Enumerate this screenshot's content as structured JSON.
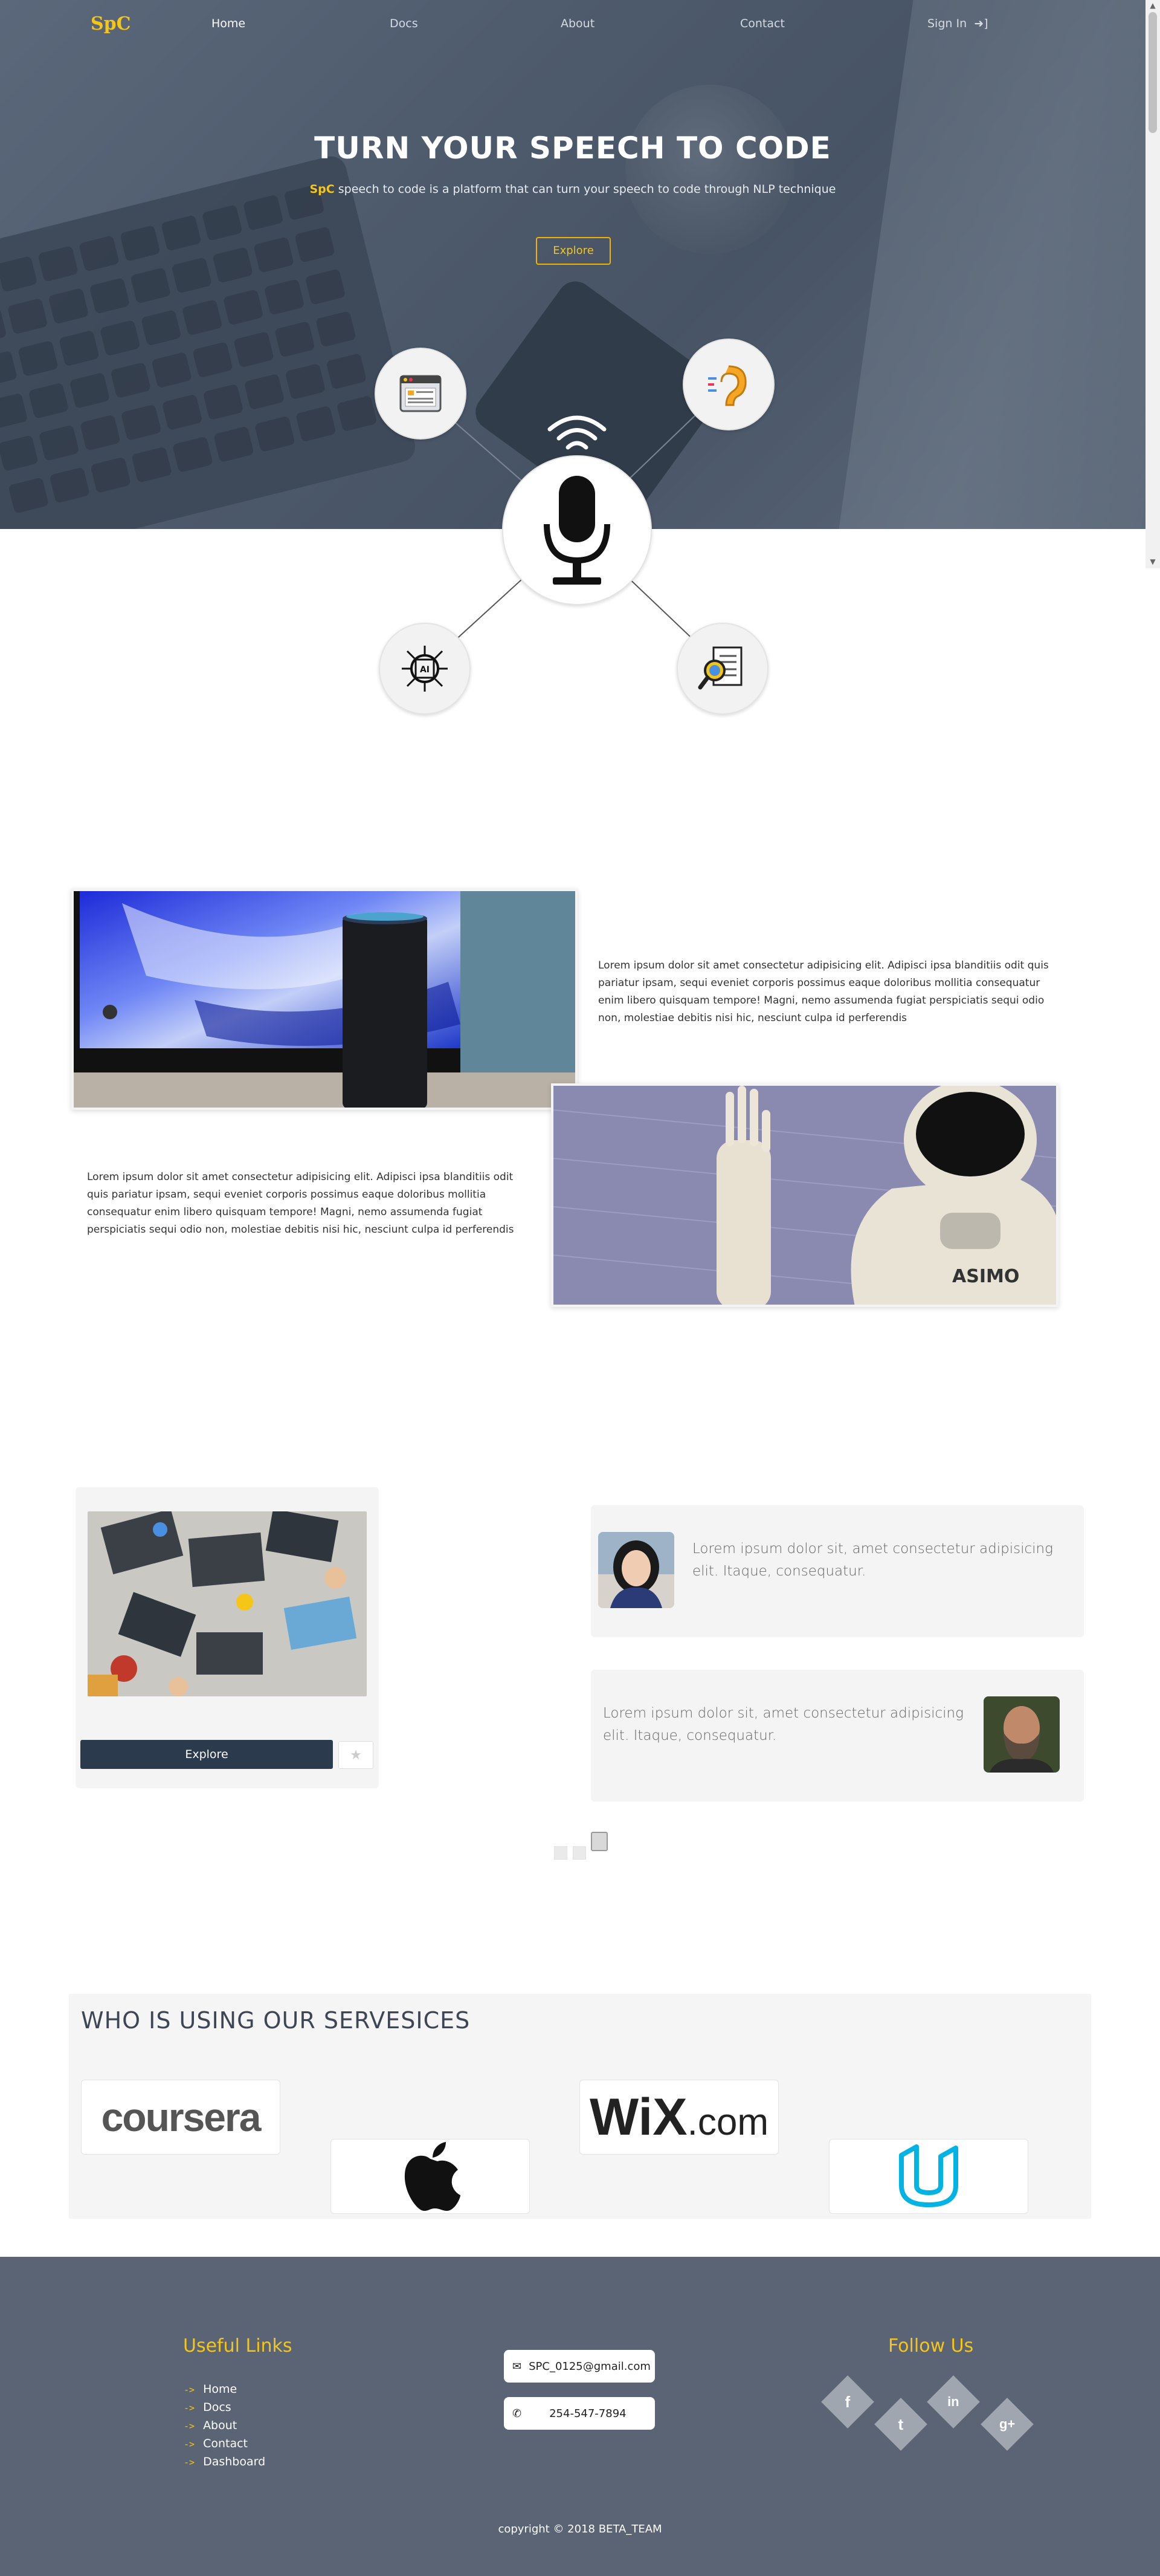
{
  "nav": {
    "brand": "SpC",
    "links": [
      "Home",
      "Docs",
      "About",
      "Contact"
    ],
    "sign_in": "Sign In"
  },
  "hero": {
    "title": "TURN YOUR SPEECH TO CODE",
    "subtitle_brand": "SpC",
    "subtitle": "speech to code is a platform that can turn your speech to code through NLP technique",
    "button": "Explore"
  },
  "diagram": {
    "center_icon": "microphone-icon",
    "nodes": [
      "browser-window-icon",
      "ear-listening-icon",
      "ai-chip-icon",
      "document-search-icon"
    ]
  },
  "features": [
    {
      "text": "Lorem ipsum dolor sit amet consectetur adipisicing elit. Adipisci ipsa blanditiis odit quis pariatur ipsam, sequi eveniet corporis possimus eaque doloribus mollitia consequatur enim libero quisquam tempore! Magni, nemo assumenda fugiat perspiciatis sequi odio non, molestiae debitis nisi hic, nesciunt culpa id perferendis"
    },
    {
      "text": "Lorem ipsum dolor sit amet consectetur adipisicing elit. Adipisci ipsa blanditiis odit quis pariatur ipsam, sequi eveniet corporis possimus eaque doloribus mollitia consequatur enim libero quisquam tempore! Magni, nemo assumenda fugiat perspiciatis sequi odio non, molestiae debitis nisi hic, nesciunt culpa id perferendis",
      "robot_label": "ASIMO"
    }
  ],
  "card": {
    "button": "Explore",
    "star_icon": "star-icon"
  },
  "testimonials": [
    {
      "text": "Lorem ipsum dolor sit, amet consectetur adipisicing elit. Itaque, consequatur."
    },
    {
      "text": "Lorem ipsum dolor sit, amet consectetur adipisicing elit. Itaque, consequatur."
    }
  ],
  "partners": {
    "title": "WHO IS USING OUR SERVESICES",
    "logos": [
      "coursera",
      "WiX.com",
      "Apple",
      "Udacity"
    ],
    "coursera_text": "coursera",
    "wix_text": "WiX",
    "wix_suffix": ".com"
  },
  "footer": {
    "links_title": "Useful Links",
    "links": [
      "Home",
      "Docs",
      "About",
      "Contact",
      "Dashboard"
    ],
    "arrow": "->",
    "email": "SPC_0125@gmail.com",
    "phone": "254-547-7894",
    "follow_title": "Follow Us",
    "social": [
      {
        "name": "facebook",
        "glyph": "f"
      },
      {
        "name": "twitter",
        "glyph": "t"
      },
      {
        "name": "linkedin",
        "glyph": "in"
      },
      {
        "name": "google-plus",
        "glyph": "g+"
      }
    ],
    "copyright": "copyright © 2018 BETA_TEAM"
  },
  "colors": {
    "accent": "#f5c518",
    "footer_bg": "#5b6474",
    "dark_button": "#2c3a4e",
    "hero_overlay": "#5a6779"
  }
}
